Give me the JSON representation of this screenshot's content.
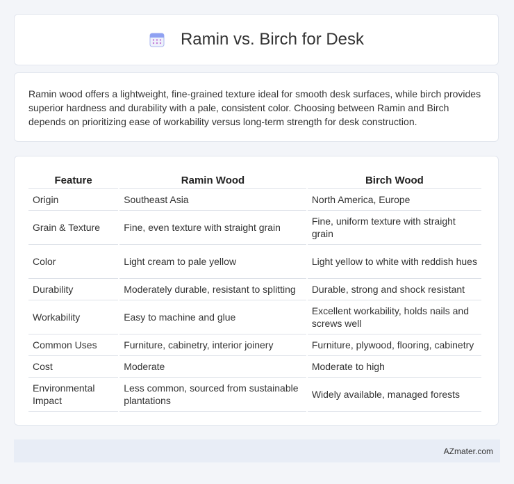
{
  "header": {
    "icon": "calendar-icon",
    "title": "Ramin vs. Birch for Desk"
  },
  "intro": {
    "text": "Ramin wood offers a lightweight, fine-grained texture ideal for smooth desk surfaces, while birch provides superior hardness and durability with a pale, consistent color. Choosing between Ramin and Birch depends on prioritizing ease of workability versus long-term strength for desk construction."
  },
  "table": {
    "headers": [
      "Feature",
      "Ramin Wood",
      "Birch Wood"
    ],
    "rows": [
      [
        "Origin",
        "Southeast Asia",
        "North America, Europe"
      ],
      [
        "Grain & Texture",
        "Fine, even texture with straight grain",
        "Fine, uniform texture with straight grain"
      ],
      [
        "Color",
        "Light cream to pale yellow",
        "Light yellow to white with reddish hues"
      ],
      [
        "Durability",
        "Moderately durable, resistant to splitting",
        "Durable, strong and shock resistant"
      ],
      [
        "Workability",
        "Easy to machine and glue",
        "Excellent workability, holds nails and screws well"
      ],
      [
        "Common Uses",
        "Furniture, cabinetry, interior joinery",
        "Furniture, plywood, flooring, cabinetry"
      ],
      [
        "Cost",
        "Moderate",
        "Moderate to high"
      ],
      [
        "Environmental Impact",
        "Less common, sourced from sustainable plantations",
        "Widely available, managed forests"
      ]
    ]
  },
  "footer": {
    "brand": "AZmater.com"
  },
  "colors": {
    "background": "#f3f5f9",
    "card": "#ffffff",
    "footer": "#e8edf6",
    "icon_accent": "#7b8cf0"
  }
}
